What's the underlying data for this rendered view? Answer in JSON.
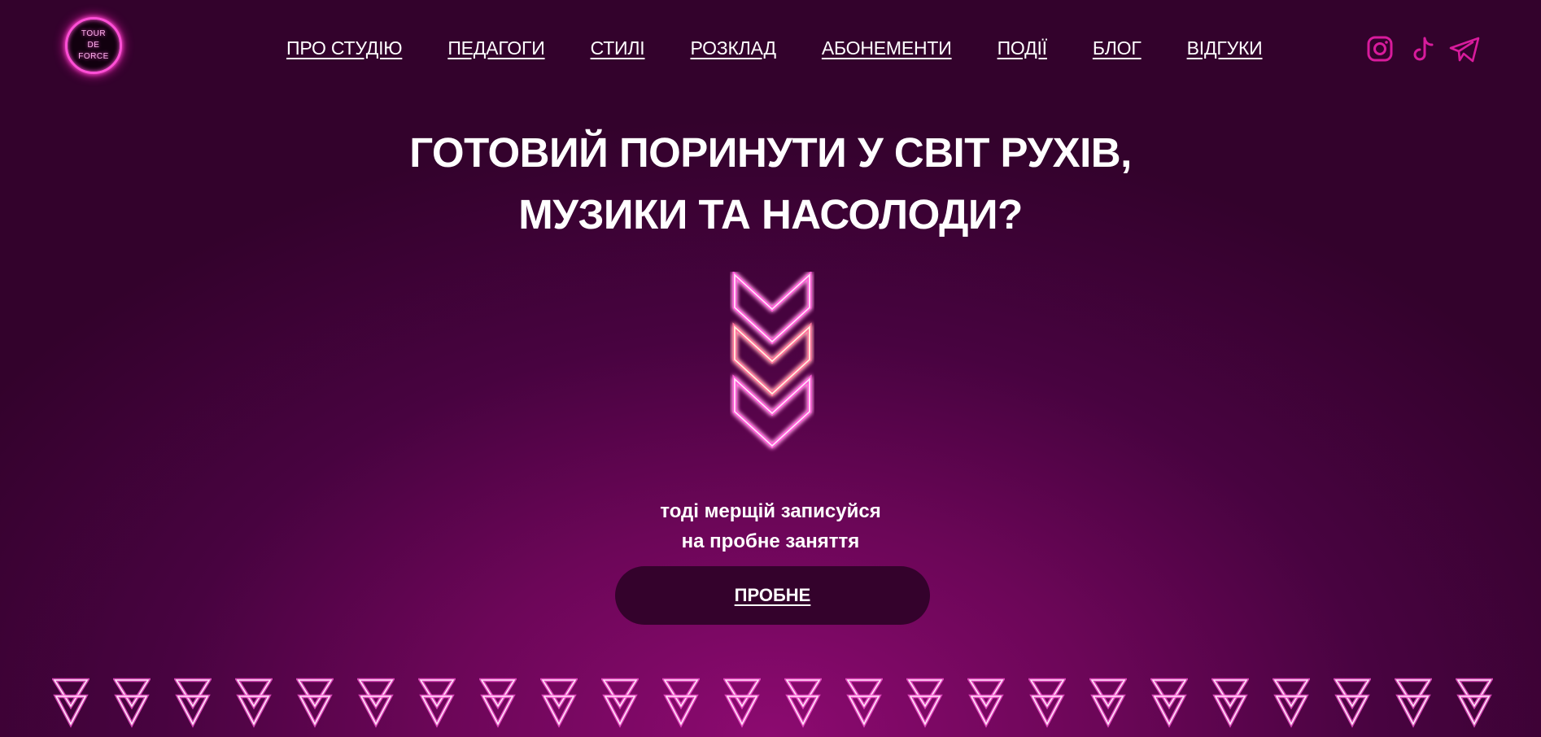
{
  "logo": {
    "lines": [
      "TOUR",
      "DE",
      "FORCE"
    ]
  },
  "nav": {
    "items": [
      {
        "label": "ПРО СТУДІЮ",
        "name": "nav-about"
      },
      {
        "label": "ПЕДАГОГИ",
        "name": "nav-teachers"
      },
      {
        "label": "СТИЛІ",
        "name": "nav-styles"
      },
      {
        "label": "РОЗКЛАД",
        "name": "nav-schedule"
      },
      {
        "label": "АБОНЕМЕНТИ",
        "name": "nav-passes"
      },
      {
        "label": "ПОДІЇ",
        "name": "nav-events"
      },
      {
        "label": "БЛОГ",
        "name": "nav-blog"
      },
      {
        "label": "ВІДГУКИ",
        "name": "nav-reviews"
      }
    ]
  },
  "social": {
    "icons": [
      "instagram-icon",
      "tiktok-icon",
      "telegram-icon"
    ],
    "color": "#d81b9c"
  },
  "hero": {
    "title_lines": [
      "ГОТОВИЙ ПОРИНУТИ У СВІТ РУХІВ,",
      "МУЗИКИ ТА НАСОЛОДИ?"
    ],
    "subtitle_lines": [
      "тоді мерщій записуйся",
      "на пробне заняття"
    ],
    "cta_label": "ПРОБНЕ",
    "decor_icon": "triple-chevron-down-icon"
  },
  "footer_decor": {
    "icon": "double-triangle-down-icon",
    "count": 24
  },
  "colors": {
    "accent": "#ff4fd6",
    "button_bg": "#34022c",
    "background": "#6c0658"
  }
}
